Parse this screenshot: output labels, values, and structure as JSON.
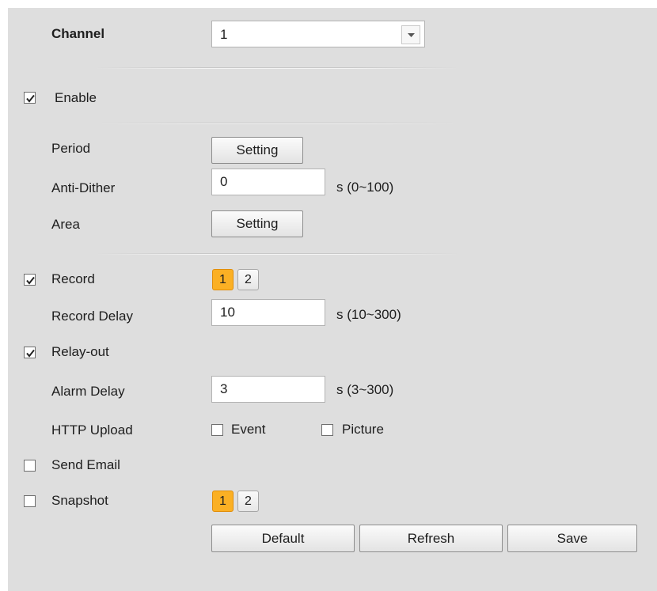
{
  "channel": {
    "label": "Channel",
    "value": "1"
  },
  "enable": {
    "label": "Enable",
    "checked": true
  },
  "period": {
    "label": "Period",
    "button": "Setting"
  },
  "anti_dither": {
    "label": "Anti-Dither",
    "value": "0",
    "range": "s (0~100)"
  },
  "area": {
    "label": "Area",
    "button": "Setting"
  },
  "record": {
    "label": "Record",
    "checked": true,
    "channels": [
      "1",
      "2"
    ]
  },
  "record_delay": {
    "label": "Record Delay",
    "value": "10",
    "range": "s (10~300)"
  },
  "relay_out": {
    "label": "Relay-out",
    "checked": true
  },
  "alarm_delay": {
    "label": "Alarm Delay",
    "value": "3",
    "range": "s (3~300)"
  },
  "http_upload": {
    "label": "HTTP Upload",
    "event_label": "Event",
    "event_checked": false,
    "picture_label": "Picture",
    "picture_checked": false
  },
  "send_email": {
    "label": "Send Email",
    "checked": false
  },
  "snapshot": {
    "label": "Snapshot",
    "checked": false,
    "channels": [
      "1",
      "2"
    ]
  },
  "actions": {
    "default": "Default",
    "refresh": "Refresh",
    "save": "Save"
  },
  "colors": {
    "panel": "#dedede",
    "active_channel": "#fbb024"
  }
}
